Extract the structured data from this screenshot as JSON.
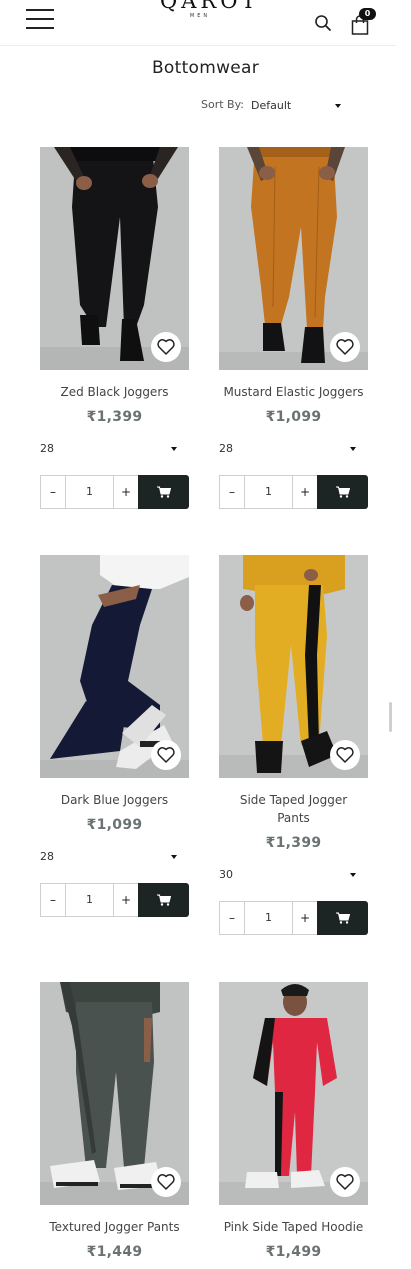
{
  "header": {
    "logo_main": "QAROT",
    "logo_sub": "MEN",
    "cart_count": "0",
    "menu_icon": "hamburger-icon",
    "search_icon": "search-icon",
    "cart_icon": "shopping-bag-icon"
  },
  "page": {
    "title": "Bottomwear",
    "sort_label": "Sort By:",
    "sort_value": "Default"
  },
  "colors": {
    "accent_dark": "#1d2424",
    "price_gray": "#6b7273"
  },
  "products": [
    {
      "name": "Zed Black Joggers",
      "price": "₹1,399",
      "size": "28",
      "qty": "1",
      "minus": "–",
      "plus": "+"
    },
    {
      "name": "Mustard Elastic Joggers",
      "price": "₹1,099",
      "size": "28",
      "qty": "1",
      "minus": "–",
      "plus": "+"
    },
    {
      "name": "Dark Blue Joggers",
      "price": "₹1,099",
      "size": "28",
      "qty": "1",
      "minus": "–",
      "plus": "+"
    },
    {
      "name": "Side Taped Jogger Pants",
      "price": "₹1,399",
      "size": "30",
      "qty": "1",
      "minus": "–",
      "plus": "+"
    },
    {
      "name": "Textured Jogger Pants",
      "price": "₹1,449"
    },
    {
      "name": "Pink Side Taped Hoodie",
      "price": "₹1,499"
    }
  ]
}
